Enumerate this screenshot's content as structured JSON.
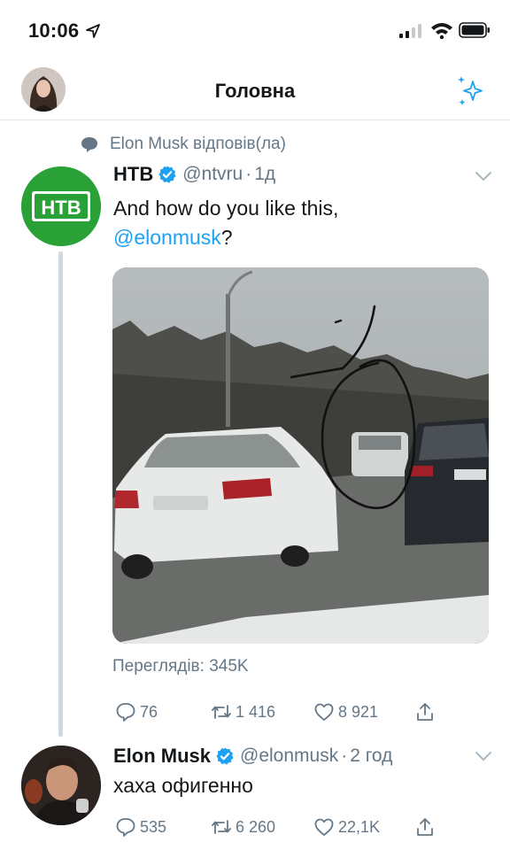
{
  "status_bar": {
    "time": "10:06"
  },
  "header": {
    "title": "Головна"
  },
  "context": {
    "text": "Elon Musk відповів(ла)"
  },
  "tweets": [
    {
      "name": "НТВ",
      "handle": "@ntvru",
      "time": "1д",
      "text_before": "And how do you like this,",
      "mention": "@elonmusk",
      "text_after": "?",
      "views_label": "Переглядів: 345K",
      "replies": "76",
      "retweets": "1 416",
      "likes": "8 921",
      "avatar_logo_text": "НТВ"
    },
    {
      "name": "Elon Musk",
      "handle": "@elonmusk",
      "time": "2 год",
      "text": "хаха офигенно",
      "replies": "535",
      "retweets": "6 260",
      "likes": "22,1K"
    }
  ],
  "icons": {
    "location": "location-arrow-icon",
    "signal": "cellular-signal-icon",
    "wifi": "wifi-icon",
    "battery": "battery-icon",
    "sparkle": "sparkle-icon",
    "reply": "reply-icon",
    "retweet": "retweet-icon",
    "like": "heart-icon",
    "share": "share-icon",
    "verified": "verified-badge-icon",
    "caret": "chevron-down-icon"
  },
  "colors": {
    "accent": "#1da1f2",
    "secondary_text": "#657786",
    "ntv_green": "#2aa137"
  }
}
